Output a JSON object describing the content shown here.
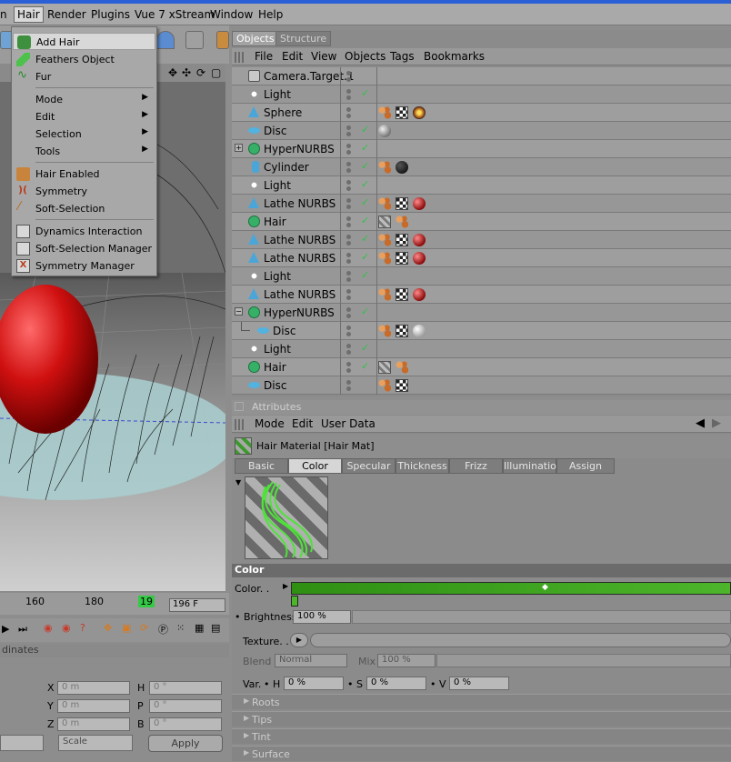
{
  "menubar": {
    "items": [
      "n",
      "Hair",
      "Render",
      "Plugins",
      "Vue 7 xStream",
      "Window",
      "Help"
    ]
  },
  "hair_menu": {
    "items": [
      {
        "label": "Add Hair",
        "icon": "add-hair-icon",
        "highlighted": true
      },
      {
        "label": "Feathers Object",
        "icon": "feather-icon"
      },
      {
        "label": "Fur",
        "icon": "fur-icon"
      },
      {
        "label": "Mode",
        "submenu": true
      },
      {
        "label": "Edit",
        "submenu": true
      },
      {
        "label": "Selection",
        "submenu": true
      },
      {
        "label": "Tools",
        "submenu": true
      },
      {
        "label": "Hair Enabled",
        "icon": "hair-enabled-icon"
      },
      {
        "label": "Symmetry",
        "icon": "symmetry-icon"
      },
      {
        "label": "Soft-Selection",
        "icon": "soft-selection-icon"
      },
      {
        "label": "Dynamics Interaction",
        "icon": "dynamics-icon"
      },
      {
        "label": "Soft-Selection Manager",
        "icon": "soft-selection-manager-icon"
      },
      {
        "label": "Symmetry Manager",
        "icon": "symmetry-manager-icon"
      }
    ]
  },
  "objects_panel": {
    "tabs": [
      "Objects",
      "Structure"
    ],
    "menu": [
      "File",
      "Edit",
      "View",
      "Objects",
      "Tags",
      "Bookmarks"
    ],
    "rows": [
      {
        "name": "Camera.Target.1",
        "icon": "camera-target-icon"
      },
      {
        "name": "Light",
        "icon": "light-icon"
      },
      {
        "name": "Sphere",
        "icon": "sphere-icon"
      },
      {
        "name": "Disc",
        "icon": "disc-icon"
      },
      {
        "name": "HyperNURBS",
        "icon": "hypernurbs-icon"
      },
      {
        "name": "Cylinder",
        "icon": "cylinder-icon"
      },
      {
        "name": "Light",
        "icon": "light-icon"
      },
      {
        "name": "Lathe NURBS",
        "icon": "lathe-icon"
      },
      {
        "name": "Hair",
        "icon": "hair-icon"
      },
      {
        "name": "Lathe NURBS",
        "icon": "lathe-icon"
      },
      {
        "name": "Lathe NURBS",
        "icon": "lathe-icon"
      },
      {
        "name": "Light",
        "icon": "light-icon"
      },
      {
        "name": "Lathe NURBS",
        "icon": "lathe-icon"
      },
      {
        "name": "HyperNURBS",
        "icon": "hypernurbs-icon"
      },
      {
        "name": "Disc",
        "icon": "disc-icon"
      },
      {
        "name": "Light",
        "icon": "light-icon"
      },
      {
        "name": "Hair",
        "icon": "hair-icon"
      },
      {
        "name": "Disc",
        "icon": "disc-icon"
      }
    ]
  },
  "attributes": {
    "header": "Attributes",
    "menu": [
      "Mode",
      "Edit",
      "User Data"
    ],
    "material_title": "Hair Material [Hair Mat]",
    "tabs": [
      "Basic",
      "Color",
      "Specular",
      "Thickness",
      "Frizz",
      "Illumination",
      "Assign"
    ],
    "active_tab": "Color",
    "section": "Color",
    "color_label": "Color. .",
    "brightness_label": "Brightness",
    "brightness_value": "100 %",
    "texture_label": "Texture. .",
    "blend_label": "Blend",
    "blend_value": "Normal",
    "mix_label": "Mix",
    "mix_value": "100 %",
    "var_label": "Var.",
    "h_label": "H",
    "h_value": "0 %",
    "s_label": "S",
    "s_value": "0 %",
    "v_label": "V",
    "v_value": "0 %",
    "collapsed_sections": [
      "Roots",
      "Tips",
      "Tint",
      "Surface"
    ]
  },
  "timeline": {
    "tick_160": "160",
    "tick_180": "180",
    "current_frame": "19",
    "end_frame": "196 F"
  },
  "coordinates": {
    "header": "dinates",
    "labels": [
      "X",
      "Y",
      "Z",
      "H",
      "P",
      "B"
    ],
    "values": [
      "0 m",
      "0 m",
      "0 m",
      "0 °",
      "0 °",
      "0 °"
    ],
    "mode_value": "Scale",
    "apply_label": "Apply"
  },
  "colors": {
    "gradient_green": "#3ea31f",
    "check_green": "#2ec24a",
    "menu_bg": "#a8a8a8"
  }
}
